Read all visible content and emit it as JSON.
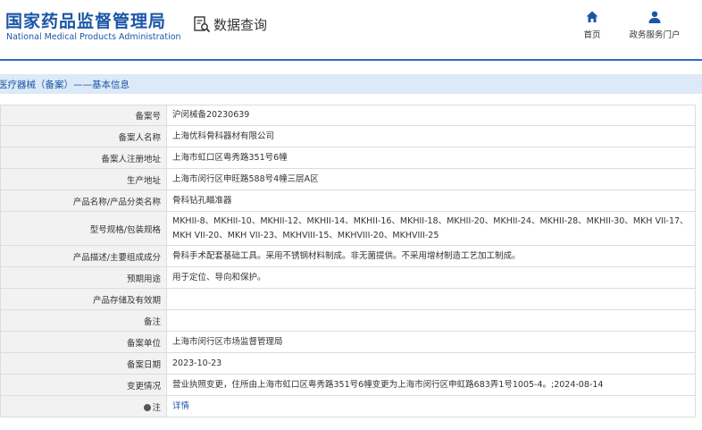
{
  "header": {
    "logo_cn": "国家药品监督管理局",
    "logo_en": "National Medical Products Administration",
    "query_label": "数据查询",
    "nav": {
      "home": "首页",
      "portal": "政务服务门户"
    },
    "accent_color": "#1a56a6"
  },
  "breadcrumb": "医疗器械（备案）——基本信息",
  "table": {
    "rows": [
      {
        "key": "备案号",
        "value": "沪闵械备20230639"
      },
      {
        "key": "备案人名称",
        "value": "上海优科骨科器材有限公司"
      },
      {
        "key": "备案人注册地址",
        "value": "上海市虹口区粤秀路351号6幢"
      },
      {
        "key": "生产地址",
        "value": "上海市闵行区申旺路588号4幢三层A区"
      },
      {
        "key": "产品名称/产品分类名称",
        "value": "骨科钻孔瞄准器"
      },
      {
        "key": "型号规格/包装规格",
        "value": "MKHII-8、MKHII-10、MKHII-12、MKHII-14、MKHII-16、MKHII-18、MKHII-20、MKHII-24、MKHII-28、MKHII-30、MKH VII-17、MKH VII-20、MKH VII-23、MKHVIII-15、MKHVIII-20、MKHVIII-25"
      },
      {
        "key": "产品描述/主要组成成分",
        "value": "骨科手术配套基础工具。采用不锈钢材料制成。非无菌提供。不采用增材制造工艺加工制成。"
      },
      {
        "key": "预期用途",
        "value": "用于定位、导向和保护。"
      },
      {
        "key": "产品存储及有效期",
        "value": ""
      },
      {
        "key": "备注",
        "value": ""
      },
      {
        "key": "备案单位",
        "value": "上海市闵行区市场监督管理局"
      },
      {
        "key": "备案日期",
        "value": "2023-10-23"
      },
      {
        "key": "变更情况",
        "value": "营业执照变更，住所由上海市虹口区粤秀路351号6幢变更为上海市闵行区申虹路683弄1号1005-4。;2024-08-14"
      },
      {
        "key": "注",
        "value": "详情"
      }
    ]
  }
}
